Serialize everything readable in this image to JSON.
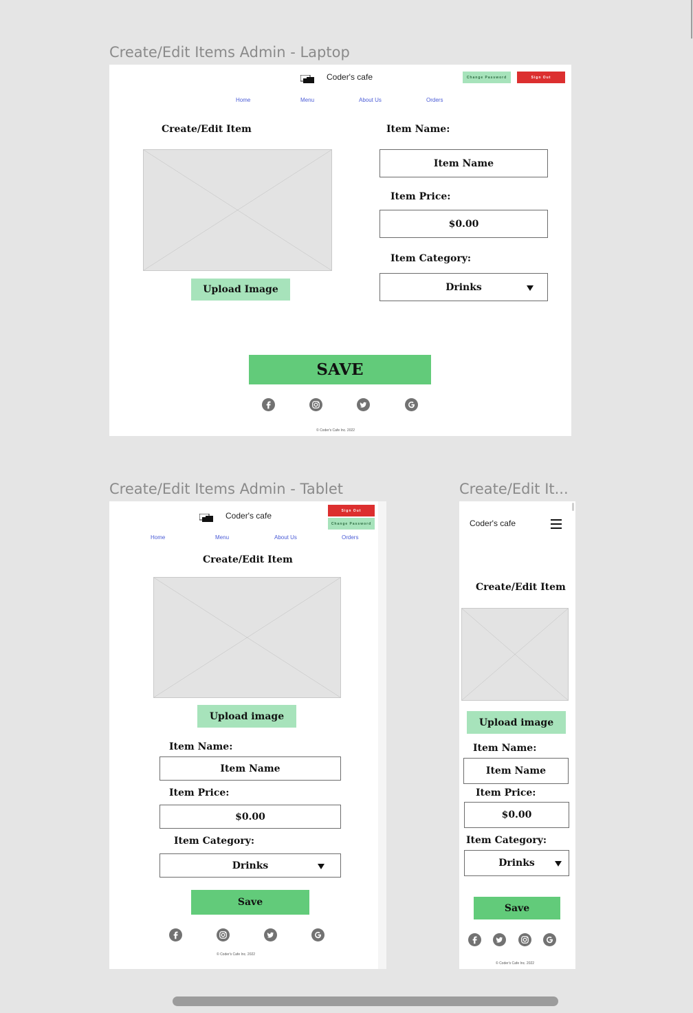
{
  "frames": {
    "laptop": {
      "label": "Create/Edit Items Admin - Laptop"
    },
    "tablet": {
      "label": "Create/Edit Items Admin - Tablet"
    },
    "mobile": {
      "label": "Create/Edit It..."
    }
  },
  "brand": {
    "name": "Coder's cafe"
  },
  "header": {
    "change_password": "Change Password",
    "sign_out": "Sign Out"
  },
  "nav": {
    "home": "Home",
    "menu": "Menu",
    "about": "About Us",
    "orders": "Orders"
  },
  "form": {
    "title": "Create/Edit Item",
    "upload_laptop": "Upload Image",
    "upload_small": "Upload image",
    "name_label": "Item Name:",
    "name_value": "Item Name",
    "price_label": "Item Price:",
    "price_value": "$0.00",
    "category_label": "Item Category:",
    "category_value": "Drinks",
    "save_laptop": "SAVE",
    "save_small": "Save"
  },
  "footer": {
    "copyright": "© Coder's Cafe Inc. 2022",
    "social_icons": [
      "facebook-icon",
      "instagram-icon",
      "twitter-icon",
      "google-icon"
    ]
  },
  "colors": {
    "green": "#62cb7a",
    "green_light": "#a7e3bb",
    "red": "#dc2f2f",
    "link": "#4a5bd6"
  }
}
